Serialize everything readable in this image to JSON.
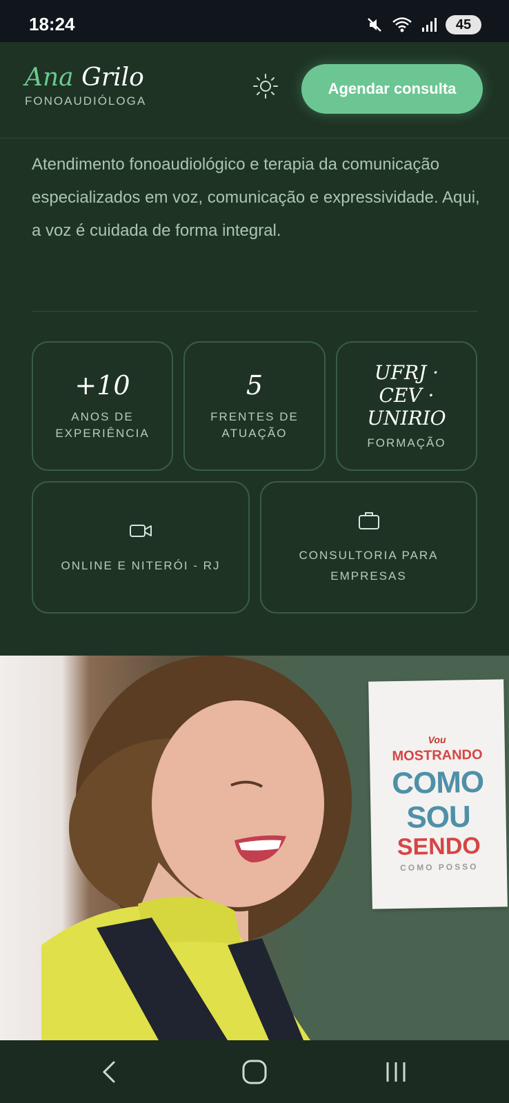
{
  "status": {
    "time": "18:24",
    "battery": "45",
    "icons": [
      "mute-icon",
      "wifi-icon",
      "signal-icon"
    ]
  },
  "header": {
    "brand_first": "Ana",
    "brand_last": "Grilo",
    "subtitle": "FONOAUDIÓLOGA",
    "theme_icon": "sun-icon",
    "cta": "Agendar consulta"
  },
  "hero": {
    "intro": "Atendimento fonoaudiológico e terapia da comunicação especializados em voz, comunicação e expressividade. Aqui, a voz é cuidada de forma integral.",
    "stats": [
      {
        "value": "+10",
        "label": "ANOS DE EXPERIÊNCIA"
      },
      {
        "value": "5",
        "label": "FRENTES DE ATUAÇÃO"
      },
      {
        "value": "UFRJ · CEV · UNIRIO",
        "label": "FORMAÇÃO"
      }
    ],
    "tags": [
      {
        "icon": "video-camera-icon",
        "label": "ONLINE E NITERÓI - RJ"
      },
      {
        "icon": "briefcase-icon",
        "label": "CONSULTORIA PARA EMPRESAS"
      }
    ]
  },
  "photo": {
    "poster_lines": [
      "Vou",
      "MOSTRANDO",
      "COMO SOU",
      "SENDO",
      "COMO POSSO"
    ]
  },
  "colors": {
    "background": "#1e3324",
    "accent": "#6cc693",
    "text": "#aac5b0"
  },
  "nav": {
    "icons": [
      "back-icon",
      "home-icon",
      "recents-icon"
    ]
  }
}
